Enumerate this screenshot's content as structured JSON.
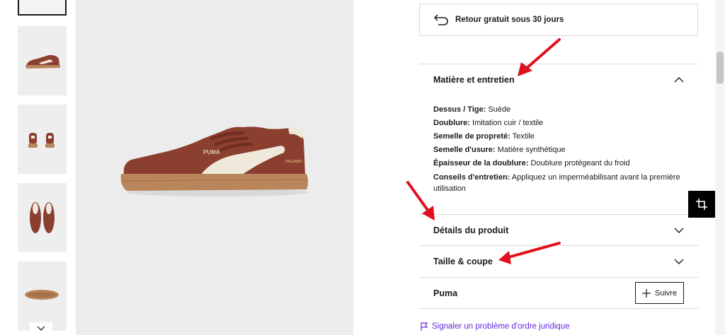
{
  "return_policy": {
    "icon": "return-arrow-icon",
    "text": "Retour gratuit sous 30 jours"
  },
  "material_section": {
    "title": "Matière et entretien",
    "expanded": true,
    "items": [
      {
        "label": "Dessus / Tige:",
        "value": " Suède"
      },
      {
        "label": "Doublure:",
        "value": " Imitation cuir / textile"
      },
      {
        "label": "Semelle de propreté:",
        "value": " Textile"
      },
      {
        "label": "Semelle d'usure:",
        "value": " Matière synthétique"
      },
      {
        "label": "Épaisseur de la doublure:",
        "value": " Doublure protégeant du froid"
      },
      {
        "label": "Conseils d'entretien:",
        "value": " Appliquez un imperméabilisant avant la première utilisation"
      }
    ]
  },
  "details_section": {
    "title": "Détails du produit",
    "expanded": false
  },
  "size_section": {
    "title": "Taille & coupe",
    "expanded": false
  },
  "brand": {
    "name": "Puma",
    "follow_label": "Suivre"
  },
  "report_link": {
    "text": "Signaler un problème d'ordre juridique",
    "color": "#6328e0"
  },
  "product_image": {
    "brand_mark": "PUMA",
    "heel_text": "PALERMO"
  },
  "colors": {
    "annotation_arrow": "#e0101e",
    "shoe_suede": "#8a3f2f",
    "sole": "#b9855a",
    "stripe": "#efe9dc"
  }
}
